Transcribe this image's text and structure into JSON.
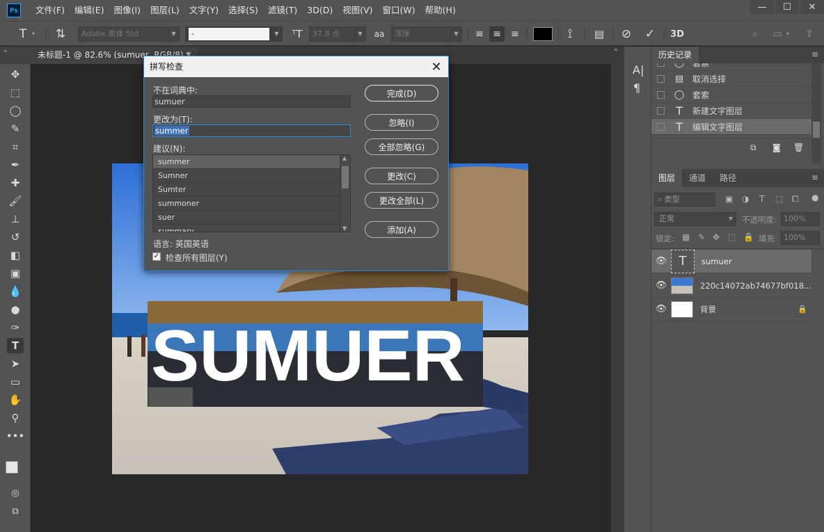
{
  "app": {
    "logo": "Ps"
  },
  "menu": [
    "文件(F)",
    "编辑(E)",
    "图像(I)",
    "图层(L)",
    "文字(Y)",
    "选择(S)",
    "滤镜(T)",
    "3D(D)",
    "视图(V)",
    "窗口(W)",
    "帮助(H)"
  ],
  "options": {
    "font_family": "Adobe 黑体 Std",
    "font_style": "-",
    "font_size": "37.8 点",
    "aa_icon": "aa",
    "antialias": "浑厚",
    "threeD_label": "3D",
    "text_color": "#000000"
  },
  "document": {
    "tab_title": "未标题-1 @ 82.6% (sumuer, RGB/8) *",
    "canvas_text": "SUMUER"
  },
  "dialog": {
    "title": "拼写检查",
    "not_in_dict_label": "不在词典中:",
    "not_in_dict_value": "sumuer",
    "change_to_label": "更改为(T):",
    "change_to_value": "summer",
    "suggestions_label": "建议(N):",
    "suggestions": [
      "summer",
      "Sumner",
      "Sumter",
      "summoner",
      "suer",
      "summary"
    ],
    "language": "语言: 英国英语",
    "check_all_layers": "检查所有图层(Y)",
    "buttons": {
      "done": "完成(D)",
      "ignore": "忽略(I)",
      "ignore_all": "全部忽略(G)",
      "change": "更改(C)",
      "change_all": "更改全部(L)",
      "add": "添加(A)"
    }
  },
  "history": {
    "tab": "历史记录",
    "items": [
      {
        "label": "套索",
        "icon": "lasso-icon"
      },
      {
        "label": "取消选择",
        "icon": "document-icon"
      },
      {
        "label": "套索",
        "icon": "lasso-icon"
      },
      {
        "label": "新建文字图层",
        "icon": "type-icon"
      },
      {
        "label": "编辑文字图层",
        "icon": "type-icon"
      }
    ]
  },
  "layers": {
    "tabs": [
      "图层",
      "通道",
      "路径"
    ],
    "filter_label": "类型",
    "blend_mode": "正常",
    "opacity_label": "不透明度:",
    "opacity_value": "100%",
    "lock_label": "锁定:",
    "fill_label": "填充:",
    "fill_value": "100%",
    "items": [
      {
        "name": "sumuer",
        "kind": "text"
      },
      {
        "name": "220c14072ab74677bf018...",
        "kind": "image"
      },
      {
        "name": "背景",
        "kind": "background"
      }
    ]
  },
  "colors": {
    "accent": "#2a88d6",
    "panel": "#535353",
    "workspace": "#282828",
    "selection": "#3f6fb6"
  }
}
